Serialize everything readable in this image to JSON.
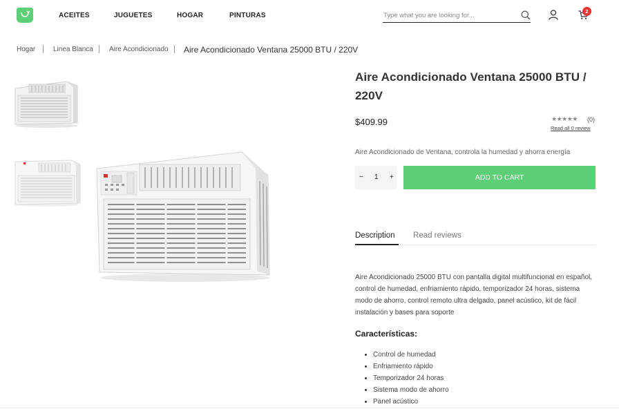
{
  "header": {
    "nav": [
      "ACEITES",
      "JUGUETES",
      "HOGAR",
      "PINTURAS"
    ],
    "search_placeholder": "Type what you are looking for...",
    "cart_count": "2",
    "brand_color": "#5ccf77"
  },
  "breadcrumb": {
    "items": [
      "Hogar",
      "Linea Blanca",
      "Aire Acondicionado"
    ],
    "current": "Aire Acondicionado Ventana 25000 BTU / 220V"
  },
  "product": {
    "title": "Aire Acondicionado Ventana 25000 BTU / 220V",
    "price": "$409.99",
    "stars": "★★★★★",
    "rating_count": "(0)",
    "read_all": "Read all 0 review",
    "short_description": "Aire Acondicionado de Ventana, controla la humedad y ahorra energía",
    "quantity": "1",
    "minus": "−",
    "plus": "+",
    "add_to_cart": "ADD TO CART"
  },
  "tabs": {
    "description": "Description",
    "reviews": "Read reviews"
  },
  "details": {
    "long_description": "Aire Acondicionado 25000 BTU con pantalla digital multifuncional en español, control de humedad, enfriamiento rápido, temporizador 24 horas, sistema modo de ahorro, control remoto ultra delgado, panel acústico, kit de fácil instalación y bases para soporte",
    "features_title": "Características:",
    "features": [
      "Control de humedad",
      "Enfriamiento rápido",
      "Temporizador 24 horas",
      "Sistema modo de ahorro",
      "Panel acústico"
    ]
  },
  "icons": {
    "logo": "shopping-bag-icon",
    "search": "search-icon",
    "user": "user-icon",
    "cart": "cart-icon"
  }
}
